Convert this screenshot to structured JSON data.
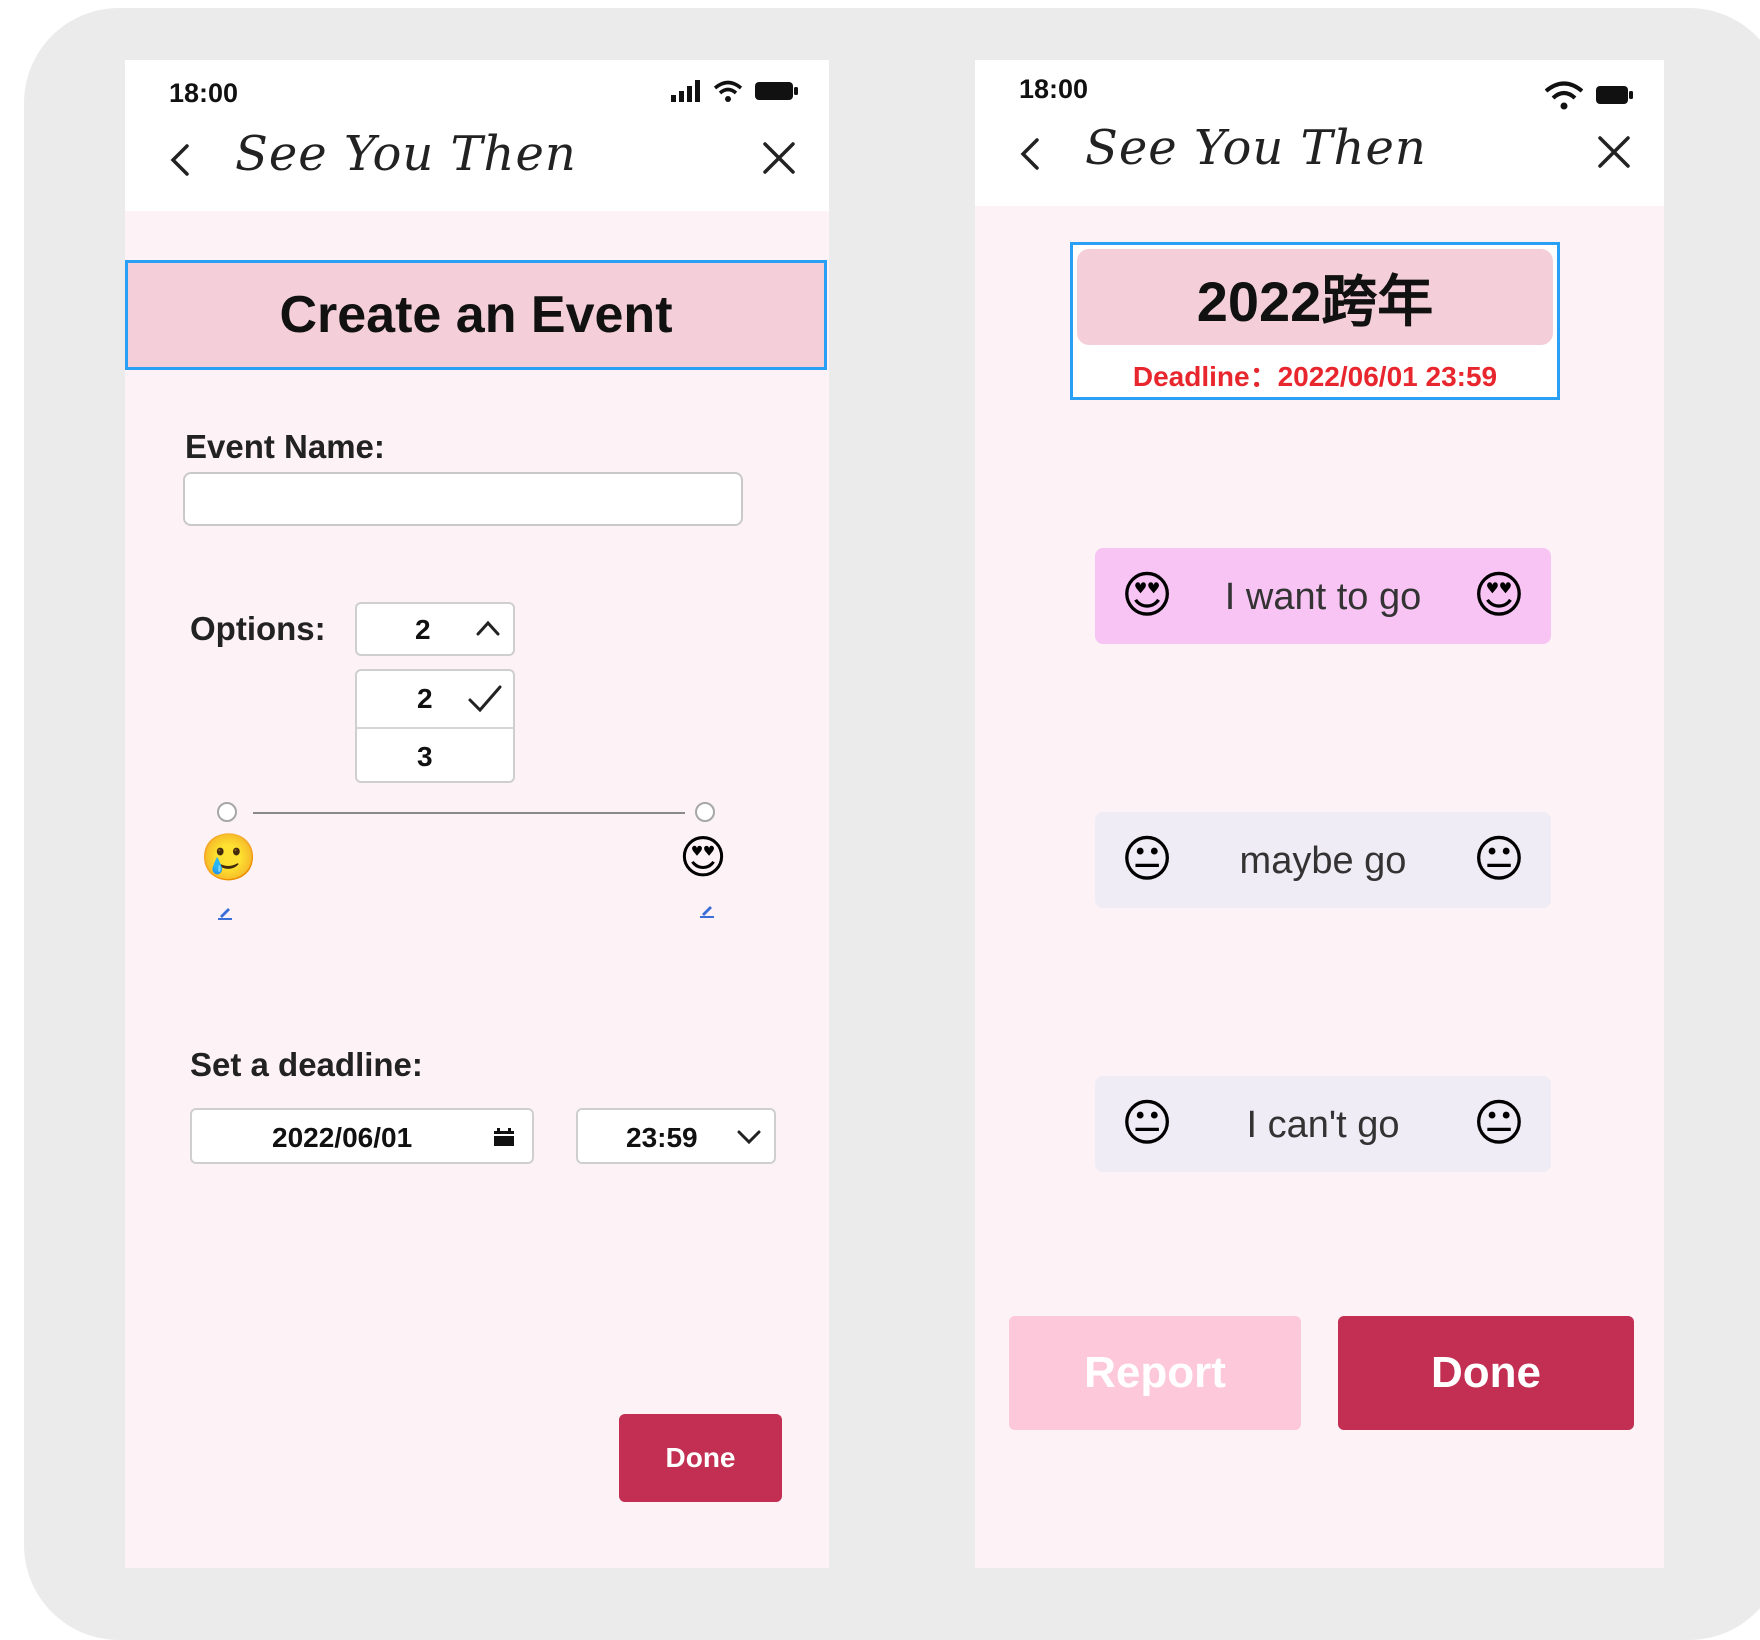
{
  "left_screen": {
    "status": {
      "time": "18:00"
    },
    "brand": "See You Then",
    "title": "Create an Event",
    "event_name_label": "Event Name:",
    "event_name_value": "",
    "options_label": "Options:",
    "options_selected": "2",
    "options_list": [
      "2",
      "3"
    ],
    "slider": {
      "left_emoji": "🥲",
      "right_emoji": "😍"
    },
    "deadline_label": "Set a deadline:",
    "deadline_date": "2022/06/01",
    "deadline_time": "23:59",
    "done_label": "Done"
  },
  "right_screen": {
    "status": {
      "time": "18:00"
    },
    "brand": "See You Then",
    "event_title": "2022跨年",
    "deadline_text": "Deadline：2022/06/01 23:59",
    "votes": [
      {
        "label": "I want to go",
        "emoji": "😍"
      },
      {
        "label": "maybe go",
        "emoji": "😐"
      },
      {
        "label": "I can't go",
        "emoji": "😐"
      }
    ],
    "report_label": "Report",
    "done_label": "Done"
  },
  "colors": {
    "accent": "#c22f52",
    "title_bg": "#f4cfd9",
    "highlight_border": "#2aa0f5",
    "report_bg": "#fcc8da",
    "deadline_red": "#e8262d"
  }
}
